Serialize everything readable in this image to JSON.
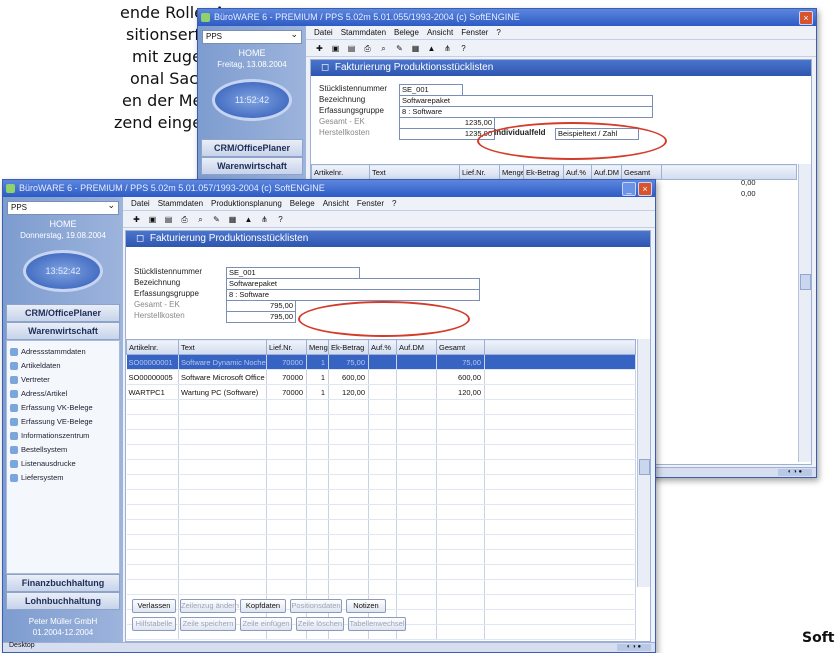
{
  "article_text": {
    "lines": [
      "ende Rolle. Aus-",
      "sitionserfassung",
      "mit zugehöriger",
      "onal Sachmerk-",
      "en der Merkma-",
      "zend eingesetzt"
    ]
  },
  "footnote": "Soft",
  "back_window": {
    "title": "BüroWARE 6 - PREMIUM / PPS 5.02m 5.01.055/1993-2004 (c) SoftENGINE",
    "combo": "PPS",
    "home": "HOME",
    "date": "Freitag, 13.08.2004",
    "clock": "11:52:42",
    "buttons": [
      "CRM/OfficePlaner",
      "Warenwirtschaft"
    ],
    "menu": [
      "Datei",
      "Stammdaten",
      "Belege",
      "Ansicht",
      "Fenster",
      "?"
    ],
    "panel_title": "Fakturierung Produktionsstücklisten",
    "fields": [
      {
        "label": "Stücklistennummer",
        "value": "SE_001"
      },
      {
        "label": "Bezeichnung",
        "value": "Softwarepaket"
      },
      {
        "label": "Erfassungsgruppe",
        "value": "8        : Software"
      },
      {
        "label": "Gesamt - EK",
        "value": "1235,00"
      },
      {
        "label": "Herstellkosten",
        "value": "1235,00"
      }
    ],
    "custom_field_label": "Individualfeld",
    "custom_field_value": "Beispieltext / Zahl",
    "columns": [
      "Artikelnr.",
      "Text",
      "Lief.Nr.",
      "Menge",
      "Ek-Betrag",
      "Auf.%",
      "Auf.DM",
      "Gesamt"
    ],
    "visible_totals": [
      "0,00",
      "0,00"
    ]
  },
  "front_window": {
    "title": "BüroWARE 6 - PREMIUM / PPS 5.02m 5.01.057/1993-2004 (c) SoftENGINE",
    "combo": "PPS",
    "home": "HOME",
    "date": "Donnerstag, 19.08.2004",
    "clock": "13:52:42",
    "buttons": {
      "crm": "CRM/OfficePlaner",
      "wawi": "Warenwirtschaft",
      "fibu": "Finanzbuchhaltung",
      "lohn": "Lohnbuchhaltung"
    },
    "nav_items": [
      "Adressstammdaten",
      "Artikeldaten",
      "Vertreter",
      "Adress/Artikel",
      "Erfassung VK-Belege",
      "Erfassung VE-Belege",
      "Informationszentrum",
      "Bestellsystem",
      "Listenausdrucke",
      "Liefersystem"
    ],
    "footer_user": "Peter Müller GmbH",
    "footer_period": "01.2004-12.2004",
    "menu": [
      "Datei",
      "Stammdaten",
      "Produktionsplanung",
      "Belege",
      "Ansicht",
      "Fenster",
      "?"
    ],
    "panel_title": "Fakturierung Produktionsstücklisten",
    "fields": {
      "nummer_label": "Stücklistennummer",
      "nummer_value": "SE_001",
      "bez_label": "Bezeichnung",
      "bez_value": "Softwarepaket",
      "gruppe_label": "Erfassungsgruppe",
      "gruppe_value": "8        : Software",
      "ek_label": "Gesamt - EK",
      "ek_value": "795,00",
      "hk_label": "Herstellkosten",
      "hk_value": "795,00"
    },
    "columns": [
      "Artikelnr.",
      "Text",
      "Lief.Nr.",
      "Menge",
      "Ek-Betrag",
      "Auf.%",
      "Auf.DM",
      "Gesamt"
    ],
    "rows": [
      [
        "SO00000001",
        "Software Dynamic Noche",
        "70000",
        "1",
        "75,00",
        "",
        "",
        "75,00"
      ],
      [
        "SO00000005",
        "Software Microsoft Office",
        "70000",
        "1",
        "600,00",
        "",
        "",
        "600,00"
      ],
      [
        "WARTPC1",
        "Wartung PC (Software)",
        "70000",
        "1",
        "120,00",
        "",
        "",
        "120,00"
      ]
    ],
    "bottom_buttons_row1": [
      "Verlassen",
      "Zeilenzug ändern",
      "Kopfdaten",
      "Positionsdaten",
      "Notizen"
    ],
    "bottom_buttons_row2": [
      "Hilfstabelle",
      "Zeile speichern",
      "Zeile einfügen",
      "Zeile löschen",
      "Tabellenwechsel"
    ],
    "start_label": "Desktop"
  }
}
